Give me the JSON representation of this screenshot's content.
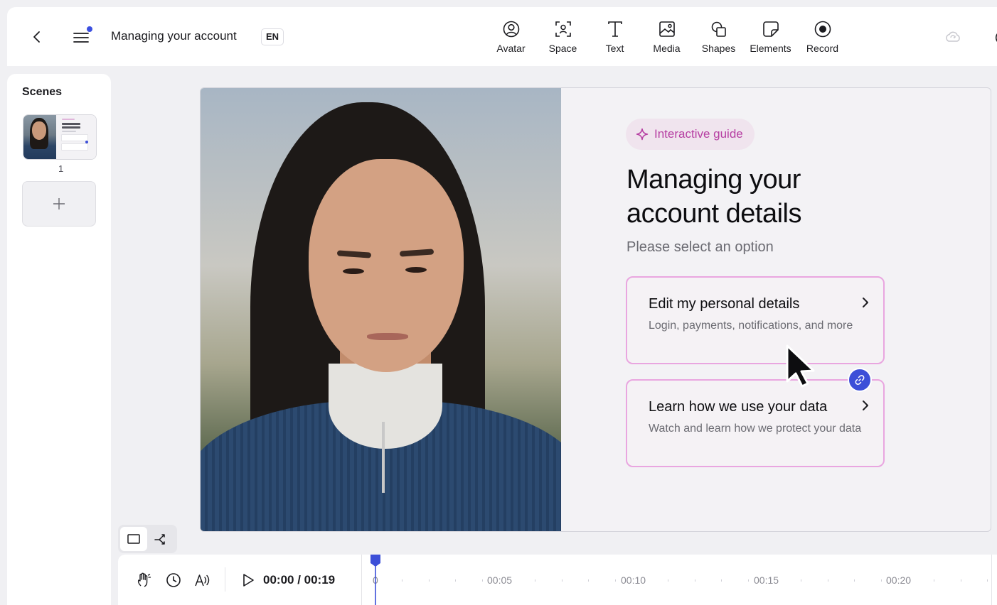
{
  "topbar": {
    "title": "Managing your account",
    "lang": "EN",
    "tools": [
      {
        "label": "Avatar",
        "icon": "avatar-icon"
      },
      {
        "label": "Space",
        "icon": "space-icon"
      },
      {
        "label": "Text",
        "icon": "text-icon"
      },
      {
        "label": "Media",
        "icon": "media-icon"
      },
      {
        "label": "Shapes",
        "icon": "shapes-icon"
      },
      {
        "label": "Elements",
        "icon": "elements-icon"
      },
      {
        "label": "Record",
        "icon": "record-icon"
      }
    ]
  },
  "scenes": {
    "title": "Scenes",
    "items": [
      {
        "number": "1"
      }
    ]
  },
  "slide": {
    "badge": "Interactive guide",
    "headline": "Managing your account details",
    "subtitle": "Please select an option",
    "options": [
      {
        "title": "Edit my personal details",
        "description": "Login, payments, notifications, and more"
      },
      {
        "title": "Learn how we use your data",
        "description": "Watch and learn how we protect your data"
      }
    ]
  },
  "timeline": {
    "time": "00:00 / 00:19",
    "ticks": [
      "0",
      "00:05",
      "00:10",
      "00:15",
      "00:20"
    ]
  },
  "colors": {
    "accent": "#3c4fd8",
    "badge_text": "#b63ea2",
    "option_border": "#e9a6e0"
  }
}
